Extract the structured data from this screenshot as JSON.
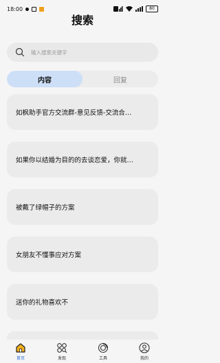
{
  "status_bar": {
    "time": "18:00",
    "battery": "80"
  },
  "header": {
    "title": "搜索"
  },
  "search": {
    "placeholder": "输入搜索关键字"
  },
  "tabs": [
    {
      "label": "内容",
      "active": true
    },
    {
      "label": "回复",
      "active": false
    }
  ],
  "results": [
    {
      "text": "如枫助手官方交流群-意见反馈-交流合…"
    },
    {
      "text": "如果你以结婚为目的的去谈恋爱，你就…"
    },
    {
      "text": "被戴了绿帽子的方案"
    },
    {
      "text": "女朋友不懂事应对方案"
    },
    {
      "text": "送你的礼物喜欢不"
    }
  ],
  "bottom_nav": [
    {
      "label": "首页",
      "icon": "home-icon",
      "active": true
    },
    {
      "label": "发现",
      "icon": "discover-icon",
      "active": false
    },
    {
      "label": "工具",
      "icon": "tools-icon",
      "active": false
    },
    {
      "label": "我的",
      "icon": "profile-icon",
      "active": false
    }
  ],
  "colors": {
    "accent": "#2a6dd8",
    "tab_active_bg": "#cddff7",
    "card_bg": "#ebebeb",
    "home_icon_fill": "#f0b020"
  }
}
